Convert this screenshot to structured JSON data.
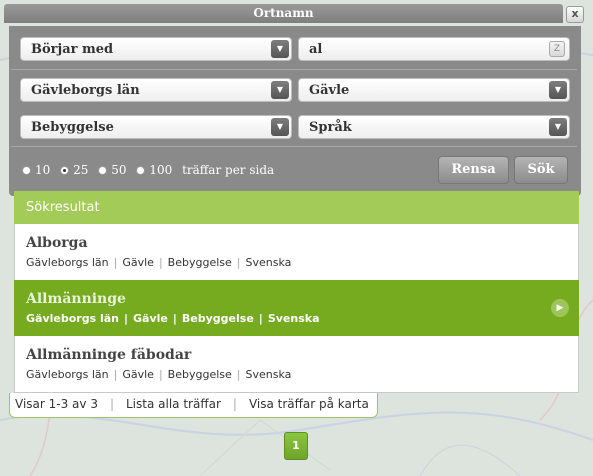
{
  "dialog": {
    "title": "Ortnamn",
    "close_label": "x"
  },
  "filters": {
    "match_mode": "Börjar med",
    "search_value": "al",
    "clear_label": "Z",
    "county": "Gävleborgs län",
    "municipality": "Gävle",
    "type": "Bebyggelse",
    "language": "Språk"
  },
  "paging": {
    "options": [
      "10",
      "25",
      "50",
      "100"
    ],
    "selected": "25",
    "suffix": "träffar per sida"
  },
  "buttons": {
    "reset": "Rensa",
    "search": "Sök"
  },
  "results": {
    "header": "Sökresultat",
    "items": [
      {
        "name": "Alborga",
        "county": "Gävleborgs län",
        "municipality": "Gävle",
        "type": "Bebyggelse",
        "language": "Svenska"
      },
      {
        "name": "Allmänninge",
        "county": "Gävleborgs län",
        "municipality": "Gävle",
        "type": "Bebyggelse",
        "language": "Svenska"
      },
      {
        "name": "Allmänninge fäbodar",
        "county": "Gävleborgs län",
        "municipality": "Gävle",
        "type": "Bebyggelse",
        "language": "Svenska"
      }
    ]
  },
  "footer": {
    "count": "Visar 1-3 av 3",
    "list_all": "Lista alla träffar",
    "show_on_map": "Visa träffar på karta"
  },
  "pagination": {
    "current": "1"
  },
  "colors": {
    "accent": "#76aa1f",
    "header_green": "#a2cb58",
    "panel_gray": "#8a8a8a"
  }
}
